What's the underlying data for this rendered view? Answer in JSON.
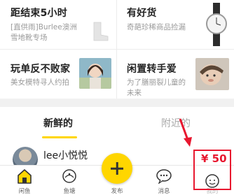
{
  "cards": [
    {
      "title": "距结束5小时",
      "subtitle_lines": [
        "[直供雨]Burlee澳洲",
        "雪地靴专场"
      ]
    },
    {
      "title": "有好货",
      "subtitle_lines": [
        "奇葩珍稀商品捡漏"
      ]
    },
    {
      "title": "玩单反不败家",
      "subtitle_lines": [
        "美女模特寻人约拍"
      ]
    },
    {
      "title": "闲置转手爱",
      "subtitle_lines": [
        "为了膳丽裂儿童的",
        "未来"
      ]
    }
  ],
  "tabs": {
    "active": "新鲜的",
    "inactive": "附近的"
  },
  "feed": {
    "username": "lee小悦悦"
  },
  "bottom_nav": {
    "home": "闲鱼",
    "pond": "鱼塘",
    "publish": "发布",
    "messages": "消息",
    "mine": "我的"
  },
  "annotation": {
    "price": "¥ 50"
  },
  "colors": {
    "accent": "#ffd600",
    "annotation_red": "#e8172f"
  }
}
